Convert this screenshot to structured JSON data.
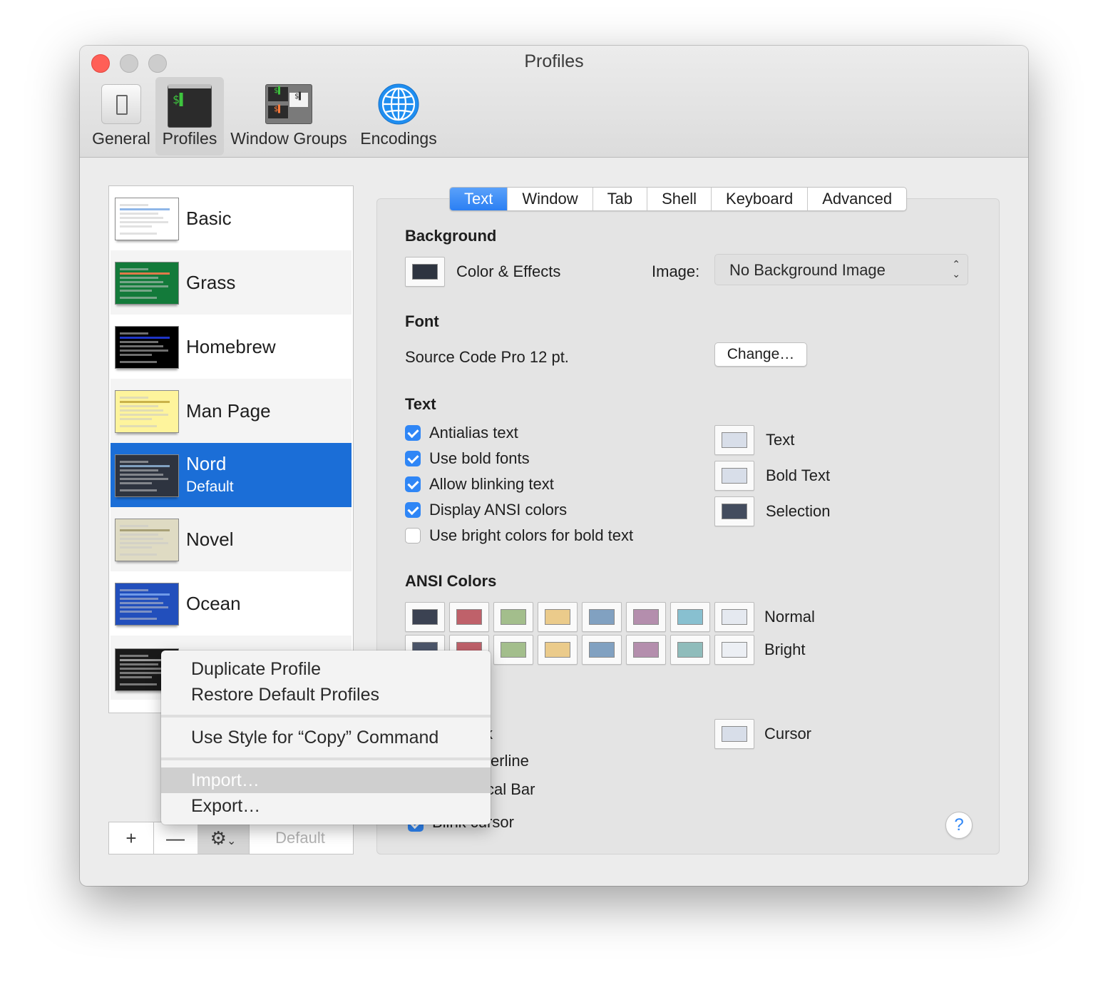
{
  "window": {
    "title": "Profiles"
  },
  "toolbar": {
    "items": [
      {
        "label": "General",
        "icon": "switch-icon"
      },
      {
        "label": "Profiles",
        "icon": "terminal-icon"
      },
      {
        "label": "Window Groups",
        "icon": "window-groups-icon"
      },
      {
        "label": "Encodings",
        "icon": "globe-icon"
      }
    ],
    "selected": "Profiles"
  },
  "profiles": {
    "items": [
      {
        "name": "Basic",
        "bg": "#ffffff",
        "accent": "#8fb6e8"
      },
      {
        "name": "Grass",
        "bg": "#137a3a",
        "accent": "#e07a4a"
      },
      {
        "name": "Homebrew",
        "bg": "#000000",
        "accent": "#1f35c8"
      },
      {
        "name": "Man Page",
        "bg": "#fef49c",
        "accent": "#c9b24a"
      },
      {
        "name": "Nord",
        "subtitle": "Default",
        "bg": "#2e3440",
        "accent": "#81a1c1"
      },
      {
        "name": "Novel",
        "bg": "#dfdbc3",
        "accent": "#a8a076"
      },
      {
        "name": "Ocean",
        "bg": "#224fbc",
        "accent": "#6f9ae8"
      }
    ],
    "partial_thumbs": [
      {
        "bg": "#1a1a1a"
      },
      {
        "bg": "#7a2a20"
      },
      {
        "bg": "#6b6f7a"
      }
    ],
    "selected": "Nord",
    "default_button": "Default",
    "add_label": "+",
    "remove_label": "—"
  },
  "tabs": {
    "items": [
      "Text",
      "Window",
      "Tab",
      "Shell",
      "Keyboard",
      "Advanced"
    ],
    "active": "Text"
  },
  "background": {
    "title": "Background",
    "color_effects_label": "Color & Effects",
    "image_label": "Image:",
    "image_value": "No Background Image",
    "swatch": "#2e3440"
  },
  "font": {
    "title": "Font",
    "value": "Source Code Pro 12 pt.",
    "change_button": "Change…"
  },
  "text": {
    "title": "Text",
    "options": [
      {
        "label": "Antialias text",
        "checked": true
      },
      {
        "label": "Use bold fonts",
        "checked": true
      },
      {
        "label": "Allow blinking text",
        "checked": true
      },
      {
        "label": "Display ANSI colors",
        "checked": true
      },
      {
        "label": "Use bright colors for bold text",
        "checked": false
      }
    ],
    "colors": [
      {
        "label": "Text",
        "color": "#d8dee9"
      },
      {
        "label": "Bold Text",
        "color": "#d8dee9"
      },
      {
        "label": "Selection",
        "color": "#434c5e"
      }
    ]
  },
  "ansi": {
    "title": "ANSI Colors",
    "normal_label": "Normal",
    "bright_label": "Bright",
    "normal": [
      "#3b4252",
      "#bf616a",
      "#a3be8c",
      "#ebcb8b",
      "#81a1c1",
      "#b48ead",
      "#88c0d0",
      "#e5e9f0"
    ],
    "bright": [
      "#4c566a",
      "#bf616a",
      "#a3be8c",
      "#ebcb8b",
      "#81a1c1",
      "#b48ead",
      "#8fbcbb",
      "#eceff4"
    ]
  },
  "cursor": {
    "label": "Cursor",
    "color": "#d8dee9",
    "visible_fragments": [
      "k",
      "erline",
      "cal Bar",
      "Blink cursor"
    ]
  },
  "menu": {
    "items": [
      "Duplicate Profile",
      "Restore Default Profiles",
      "Use Style for “Copy” Command",
      "Import…",
      "Export…"
    ],
    "highlighted": "Import…"
  },
  "help_label": "?"
}
